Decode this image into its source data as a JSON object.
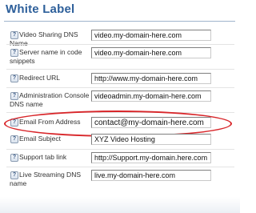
{
  "panel": {
    "title": "White Label"
  },
  "help_icon_glyph": "?",
  "fields": [
    {
      "label": "Video Sharing DNS Name",
      "value": "video.my-domain-here.com"
    },
    {
      "label": "Server name in code snippets",
      "value": "video.my-domain-here.com"
    },
    {
      "label": "Redirect URL",
      "value": "http://www.my-domain-here.com"
    },
    {
      "label": "Administration Console DNS name",
      "value": "videoadmin.my-domain-here.com"
    },
    {
      "label": "Email From Address",
      "value": "contact@my-domain-here.com"
    },
    {
      "label": "Email Subject",
      "value": "XYZ Video Hosting"
    },
    {
      "label": "Support tab link",
      "value": "http://Support.my-domain.here.com"
    },
    {
      "label": "Live Streaming DNS name",
      "value": "live.my-domain-here.com"
    }
  ],
  "colors": {
    "title": "#2d5f9a",
    "highlight_ellipse": "#d8262a"
  },
  "icons": [
    "help-icon"
  ]
}
